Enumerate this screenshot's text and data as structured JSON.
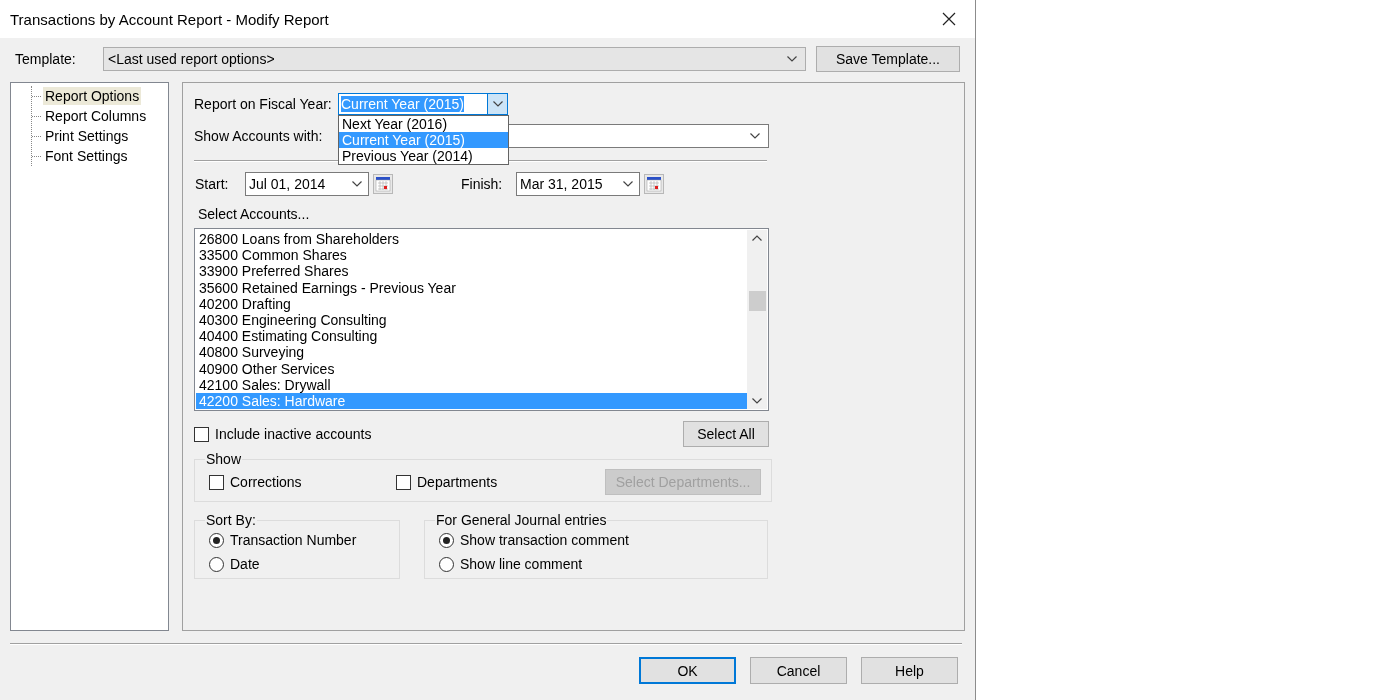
{
  "window": {
    "title": "Transactions by Account Report - Modify Report"
  },
  "template": {
    "label": "Template:",
    "value": "<Last used report options>",
    "save_button": "Save Template..."
  },
  "tree": {
    "items": [
      {
        "label": "Report Options",
        "selected": true
      },
      {
        "label": "Report Columns",
        "selected": false
      },
      {
        "label": "Print Settings",
        "selected": false
      },
      {
        "label": "Font Settings",
        "selected": false
      }
    ]
  },
  "fiscal_year": {
    "label": "Report on Fiscal Year:",
    "value": "Current Year (2015)",
    "expanded": true,
    "options": [
      {
        "label": "Next Year (2016)",
        "selected": false
      },
      {
        "label": "Current Year (2015)",
        "selected": true
      },
      {
        "label": "Previous Year (2014)",
        "selected": false
      }
    ]
  },
  "show_accounts": {
    "label": "Show Accounts with:"
  },
  "start": {
    "label": "Start:",
    "value": "Jul 01, 2014"
  },
  "finish": {
    "label": "Finish:",
    "value": "Mar 31, 2015"
  },
  "accounts": {
    "label": "Select Accounts...",
    "items": [
      {
        "label": "26800 Loans from Shareholders",
        "selected": false
      },
      {
        "label": "33500 Common Shares",
        "selected": false
      },
      {
        "label": "33900 Preferred Shares",
        "selected": false
      },
      {
        "label": "35600 Retained Earnings - Previous Year",
        "selected": false
      },
      {
        "label": "40200 Drafting",
        "selected": false
      },
      {
        "label": "40300 Engineering Consulting",
        "selected": false
      },
      {
        "label": "40400 Estimating Consulting",
        "selected": false
      },
      {
        "label": "40800 Surveying",
        "selected": false
      },
      {
        "label": "40900 Other Services",
        "selected": false
      },
      {
        "label": "42100 Sales: Drywall",
        "selected": false
      },
      {
        "label": "42200 Sales: Hardware",
        "selected": true
      }
    ]
  },
  "include_inactive": {
    "label": "Include inactive accounts",
    "checked": false
  },
  "select_all": "Select All",
  "show_group": {
    "title": "Show",
    "options": [
      {
        "label": "Corrections",
        "checked": false
      },
      {
        "label": "Departments",
        "checked": false
      }
    ],
    "button": {
      "label": "Select Departments...",
      "disabled": true
    }
  },
  "sort_by": {
    "title": "Sort By:",
    "options": [
      {
        "label": "Transaction Number",
        "selected": true
      },
      {
        "label": "Date",
        "selected": false
      }
    ]
  },
  "journal": {
    "title": "For General Journal entries",
    "options": [
      {
        "label": "Show transaction comment",
        "selected": true
      },
      {
        "label": "Show line comment",
        "selected": false
      }
    ]
  },
  "buttons": [
    {
      "label": "OK",
      "default": true
    },
    {
      "label": "Cancel",
      "default": false
    },
    {
      "label": "Help",
      "default": false
    }
  ]
}
